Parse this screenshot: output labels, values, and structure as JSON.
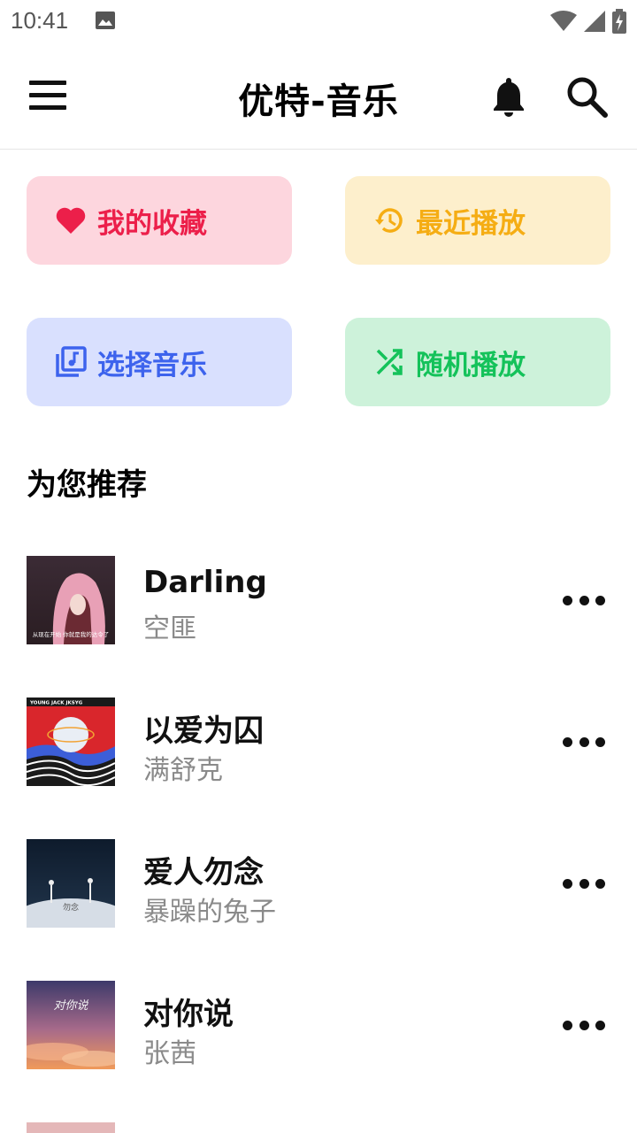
{
  "status_bar": {
    "time": "10:41",
    "icons": [
      "image-icon",
      "wifi-icon",
      "signal-icon",
      "battery-charging-icon"
    ]
  },
  "app_bar": {
    "title": "优特-音乐",
    "icons": [
      "menu-icon",
      "bell-icon",
      "search-icon"
    ]
  },
  "quick_actions": [
    {
      "label": "我的收藏",
      "icon": "heart-icon",
      "color": "#ec1f4a",
      "bg": "#fdd6de"
    },
    {
      "label": "最近播放",
      "icon": "history-icon",
      "color": "#f5ad14",
      "bg": "#fdefcc"
    },
    {
      "label": "选择音乐",
      "icon": "music-library-icon",
      "color": "#3d63ed",
      "bg": "#d9e0fe"
    },
    {
      "label": "随机播放",
      "icon": "shuffle-icon",
      "color": "#14c25a",
      "bg": "#cdf2da"
    }
  ],
  "section": {
    "title": "为您推荐"
  },
  "songs": [
    {
      "title": "Darling",
      "artist": "空匪",
      "cover_text": "从现在开始 你就是我的达令了"
    },
    {
      "title": "以爱为囚",
      "artist": "满舒克",
      "cover_text": "YOUNG JACK JKSYG"
    },
    {
      "title": "爱人勿念",
      "artist": "暴躁的兔子",
      "cover_text": "勿念"
    },
    {
      "title": "对你说",
      "artist": "张茜",
      "cover_text": "对你说"
    }
  ]
}
